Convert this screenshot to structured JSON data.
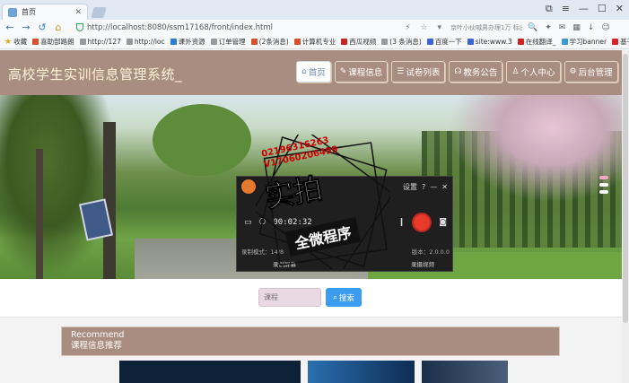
{
  "browser": {
    "tab_title": "首页",
    "tab_close": "✕",
    "url": "http://localhost:8080/ssm17168/front/index.html",
    "hint": "京叶小伙喊男办理1万 标出",
    "window_controls": [
      "⧉",
      "≡",
      "—",
      "☐",
      "✕"
    ]
  },
  "bookmarks": [
    "收藏",
    "喜助部路朗",
    "http://127",
    "http://loc",
    "课外资源",
    "订单管理",
    "(2条消息)",
    "计算机专业",
    "西瓜视频",
    "(3 条消息)",
    "百度一下",
    "site:www.3",
    "在线翻译_",
    "学习banner",
    "基于Spri"
  ],
  "site": {
    "title": "高校学生实训信息管理系统_",
    "menu": [
      {
        "label": "首页",
        "icon": "⌂",
        "active": true
      },
      {
        "label": "课程信息",
        "icon": "✎",
        "active": false
      },
      {
        "label": "试卷列表",
        "icon": "☰",
        "active": false
      },
      {
        "label": "教务公告",
        "icon": "☊",
        "active": false
      },
      {
        "label": "个人中心",
        "icon": "♙",
        "active": false
      },
      {
        "label": "后台管理",
        "icon": "⚙",
        "active": false
      }
    ]
  },
  "recorder": {
    "settings": "设置",
    "help": "?",
    "time": "00:02:32",
    "record_mode": "录制模式：14/8",
    "version": "版本：2.0.0.0",
    "left_action": "录制屏幕",
    "right_action": "录摄视频"
  },
  "watermark": {
    "numbers": "02196316263\nV17060206499",
    "big_text": "实拍",
    "banner_text": "全微程序"
  },
  "search": {
    "placeholder": "课程",
    "button_label": "搜索"
  },
  "recommend": {
    "en": "Recommend",
    "cn": "课程信息推荐"
  },
  "colors": {
    "header_bg": "#a88d80",
    "search_btn": "#3c9cf0",
    "title_color": "#fff4d6"
  }
}
